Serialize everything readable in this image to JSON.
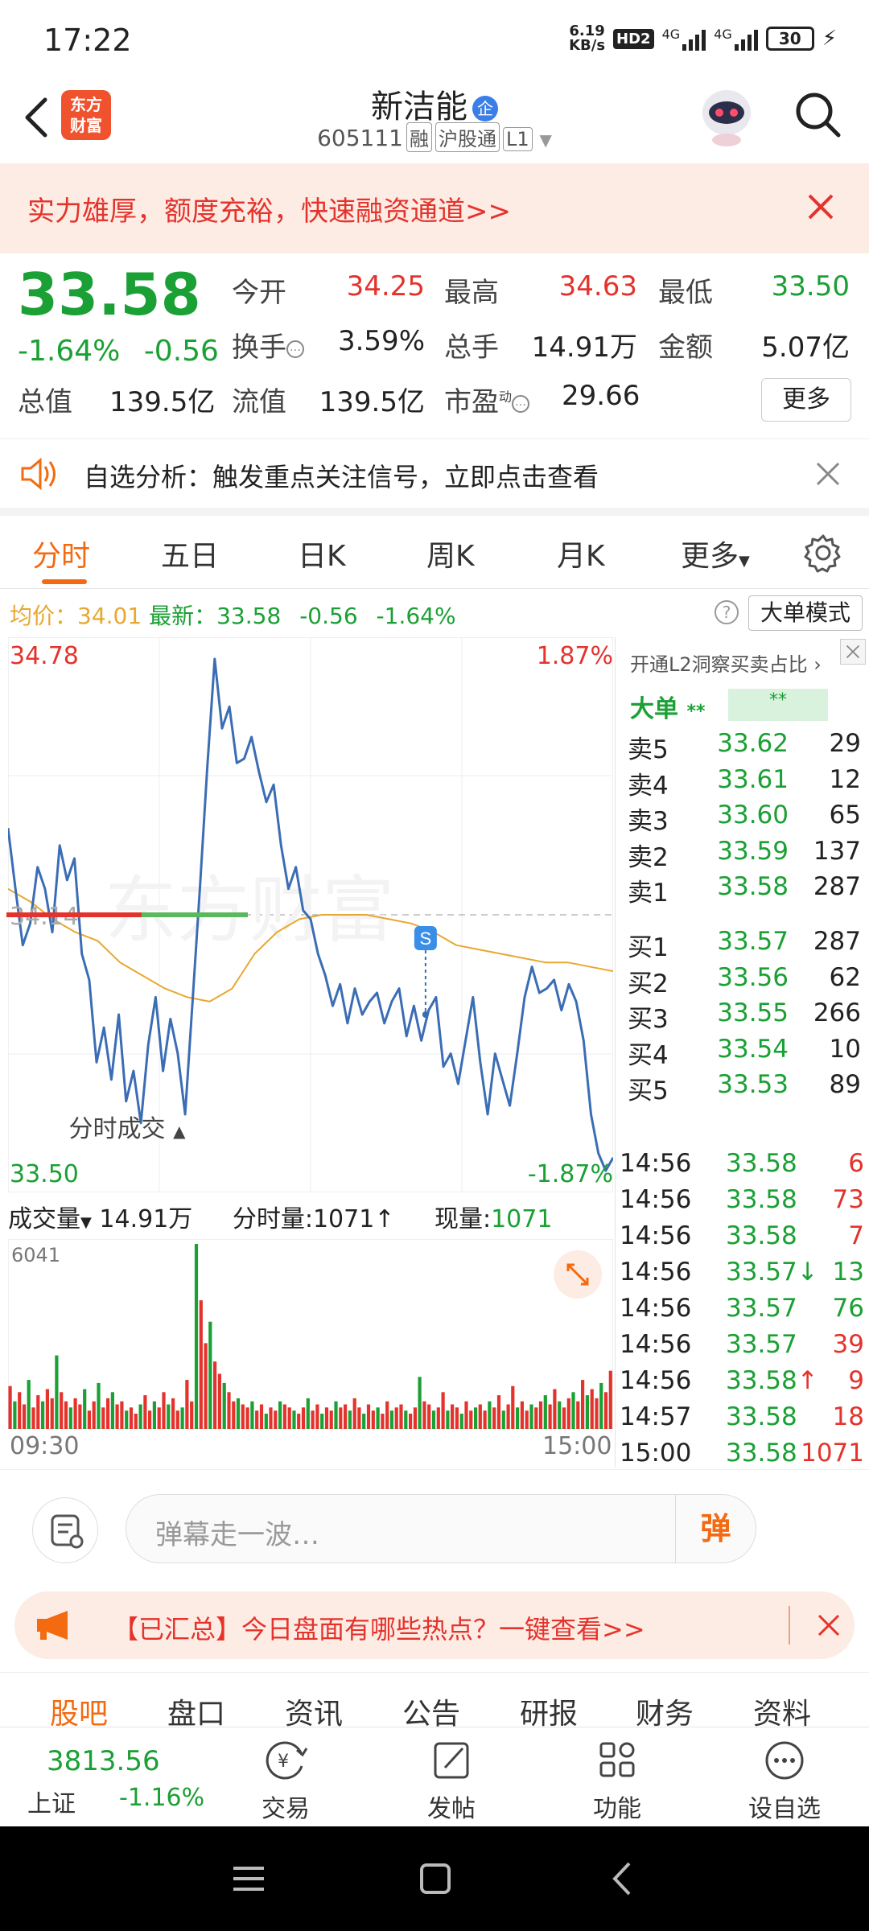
{
  "status": {
    "time": "17:22",
    "net_speed_top": "6.19",
    "net_speed_unit": "KB/s",
    "hd": "HD2",
    "sig1": "4G",
    "sig2": "4G",
    "battery": "30"
  },
  "header": {
    "title": "新洁能",
    "qi_badge": "企",
    "code": "605111",
    "tags": [
      "融",
      "沪股通",
      "L1"
    ],
    "logo_line1": "东方",
    "logo_line2": "财富"
  },
  "promo": {
    "text": "实力雄厚，额度充裕，快速融资通道>>"
  },
  "quote": {
    "price": "33.58",
    "change_pct": "-1.64%",
    "change": "-0.56",
    "open_label": "今开",
    "open": "34.25",
    "high_label": "最高",
    "high": "34.63",
    "low_label": "最低",
    "low": "33.50",
    "turnover_label": "换手",
    "turnover": "3.59%",
    "volume_label": "总手",
    "volume": "14.91万",
    "amount_label": "金额",
    "amount": "5.07亿",
    "mktcap_label": "总值",
    "mktcap": "139.5亿",
    "float_label": "流值",
    "float": "139.5亿",
    "pe_label": "市盈",
    "pe_sup": "动",
    "pe": "29.66",
    "more": "更多"
  },
  "analysis": {
    "text": "自选分析：触发重点关注信号，立即点击查看"
  },
  "tabs": [
    "分时",
    "五日",
    "日K",
    "周K",
    "月K",
    "更多"
  ],
  "info": {
    "avg_label": "均价：",
    "avg": "34.01",
    "latest_label": "最新：",
    "latest": "33.58",
    "chg": "-0.56",
    "pct": "-1.64%",
    "help": "?",
    "big_order": "大单模式"
  },
  "chart_labels": {
    "max_price": "34.78",
    "max_pct": "1.87%",
    "mid_price": "34.14",
    "min_price": "33.50",
    "min_pct": "-1.87%",
    "s_marker": "S"
  },
  "volume": {
    "label": "成交量",
    "total": "14.91万",
    "minute_label": "分时量:",
    "minute": "1071",
    "now_label": "现量:",
    "now": "1071",
    "max": "6041",
    "t_start": "09:30",
    "t_end": "15:00"
  },
  "rpanel": {
    "head": "开通L2洞察买卖占比",
    "dd_label": "大单",
    "dd_stars1": "**",
    "dd_stars2": "**",
    "asks": [
      {
        "n": "卖5",
        "p": "33.62",
        "v": "29"
      },
      {
        "n": "卖4",
        "p": "33.61",
        "v": "12"
      },
      {
        "n": "卖3",
        "p": "33.60",
        "v": "65"
      },
      {
        "n": "卖2",
        "p": "33.59",
        "v": "137"
      },
      {
        "n": "卖1",
        "p": "33.58",
        "v": "287"
      }
    ],
    "bids": [
      {
        "n": "买1",
        "p": "33.57",
        "v": "287"
      },
      {
        "n": "买2",
        "p": "33.56",
        "v": "62"
      },
      {
        "n": "买3",
        "p": "33.55",
        "v": "266"
      },
      {
        "n": "买4",
        "p": "33.54",
        "v": "10"
      },
      {
        "n": "买5",
        "p": "33.53",
        "v": "89"
      }
    ],
    "ticks_head": "分时成交",
    "ticks": [
      {
        "t": "14:56",
        "p": "33.58",
        "v": "6",
        "dir": "buy",
        "arrow": ""
      },
      {
        "t": "14:56",
        "p": "33.58",
        "v": "73",
        "dir": "buy",
        "arrow": ""
      },
      {
        "t": "14:56",
        "p": "33.58",
        "v": "7",
        "dir": "buy",
        "arrow": ""
      },
      {
        "t": "14:56",
        "p": "33.57",
        "v": "13",
        "dir": "sell",
        "arrow": "↓"
      },
      {
        "t": "14:56",
        "p": "33.57",
        "v": "76",
        "dir": "sell",
        "arrow": ""
      },
      {
        "t": "14:56",
        "p": "33.57",
        "v": "39",
        "dir": "buy",
        "arrow": ""
      },
      {
        "t": "14:56",
        "p": "33.58",
        "v": "9",
        "dir": "buy",
        "arrow": "↑"
      },
      {
        "t": "14:57",
        "p": "33.58",
        "v": "18",
        "dir": "buy",
        "arrow": ""
      },
      {
        "t": "15:00",
        "p": "33.58",
        "v": "1071",
        "dir": "buy",
        "arrow": ""
      }
    ]
  },
  "comment": {
    "placeholder": "弹幕走一波…",
    "dan": "弹"
  },
  "hot": {
    "text": "【已汇总】今日盘面有哪些热点？一键查看>>"
  },
  "subtabs": [
    "股吧",
    "盘口",
    "资讯",
    "公告",
    "研报",
    "财务",
    "资料"
  ],
  "bottom": {
    "index_value": "3813.56",
    "index_name": "上证",
    "index_chg": "-1.16%",
    "items": [
      "交易",
      "发帖",
      "功能",
      "设自选"
    ]
  },
  "colors": {
    "up": "#e4332d",
    "down": "#1aa034",
    "accent": "#f36a10",
    "price_line": "#3b6db5",
    "avg_line": "#e8a830"
  },
  "chart_data": [
    {
      "type": "line",
      "title": "",
      "x_range": [
        "09:30",
        "15:00"
      ],
      "ylim": [
        33.5,
        34.78
      ],
      "prev_close": 34.14,
      "series": [
        {
          "values": [
            34.34,
            34.2,
            34.07,
            34.12,
            34.25,
            34.2,
            34.1,
            34.3,
            34.22,
            34.27,
            34.05,
            33.99,
            33.8,
            33.88,
            33.76,
            33.91,
            33.71,
            33.78,
            33.66,
            33.84,
            33.95,
            33.78,
            33.9,
            33.82,
            33.68,
            33.94,
            34.2,
            34.48,
            34.73,
            34.57,
            34.62,
            34.49,
            34.5,
            34.55,
            34.47,
            34.4,
            34.44,
            34.3,
            34.2,
            34.25,
            34.15,
            34.13,
            34.05,
            34.0,
            33.93,
            33.98,
            33.89,
            33.97,
            33.91,
            33.94,
            33.96,
            33.89,
            33.94,
            33.97,
            33.86,
            33.93,
            33.85,
            33.92,
            33.95,
            33.79,
            33.82,
            33.75,
            33.85,
            33.95,
            33.8,
            33.68,
            33.82,
            33.76,
            33.7,
            33.82,
            33.95,
            34.02,
            33.96,
            33.97,
            33.99,
            33.92,
            33.98,
            33.94,
            33.85,
            33.68,
            33.59,
            33.55,
            33.58
          ]
        },
        {
          "values": [
            34.2,
            34.17,
            34.13,
            34.1,
            34.08,
            34.03,
            34.0,
            33.97,
            33.95,
            33.94,
            33.97,
            34.05,
            34.1,
            34.13,
            34.14,
            34.14,
            34.14,
            34.13,
            34.12,
            34.1,
            34.07,
            34.06,
            34.05,
            34.04,
            34.03,
            34.03,
            34.02,
            34.01
          ]
        }
      ]
    },
    {
      "type": "bar",
      "title": "",
      "ylim": [
        0,
        6041
      ],
      "x_range": [
        "09:30",
        "15:00"
      ],
      "values": [
        1400,
        900,
        1200,
        800,
        1600,
        700,
        1100,
        900,
        1300,
        1000,
        2400,
        1200,
        900,
        700,
        1000,
        800,
        1300,
        600,
        900,
        1500,
        700,
        1000,
        1200,
        800,
        900,
        600,
        700,
        500,
        800,
        1100,
        600,
        900,
        700,
        1200,
        800,
        1000,
        600,
        700,
        1600,
        900,
        6041,
        4200,
        2800,
        3500,
        2200,
        1800,
        1500,
        1200,
        900,
        1000,
        800,
        700,
        900,
        600,
        800,
        500,
        700,
        600,
        900,
        800,
        700,
        600,
        500,
        700,
        1000,
        600,
        800,
        500,
        700,
        600,
        900,
        700,
        800,
        600,
        1000,
        700,
        500,
        800,
        600,
        700,
        500,
        900,
        600,
        700,
        800,
        600,
        500,
        700,
        1700,
        900,
        800,
        600,
        700,
        1200,
        600,
        800,
        700,
        500,
        900,
        600,
        700,
        800,
        600,
        900,
        700,
        1100,
        600,
        800,
        1400,
        700,
        900,
        600,
        800,
        700,
        900,
        1100,
        800,
        1300,
        900,
        700,
        1000,
        1200,
        900,
        1600,
        1100,
        1300,
        1000,
        1500,
        1200,
        1900
      ]
    }
  ]
}
